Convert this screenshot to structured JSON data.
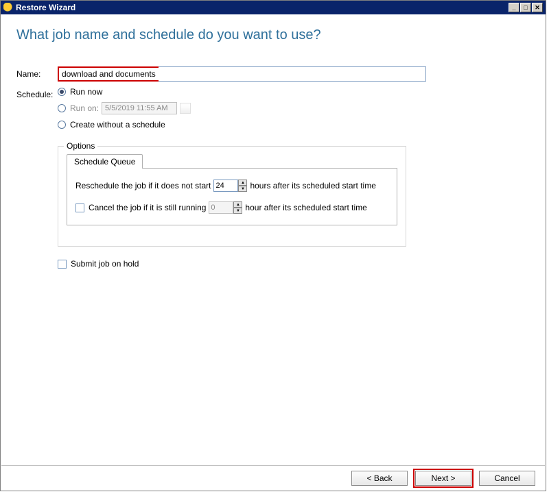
{
  "window": {
    "title": "Restore Wizard"
  },
  "heading": "What job name and schedule do you want to use?",
  "name": {
    "label": "Name:",
    "value": "download and documents"
  },
  "schedule": {
    "label": "Schedule:",
    "options": {
      "run_now": "Run now",
      "run_on": "Run on:",
      "run_on_date": "5/5/2019 11:55 AM",
      "create_without": "Create without a schedule"
    }
  },
  "options": {
    "legend": "Options",
    "tab": "Schedule Queue",
    "reschedule_pre": "Reschedule the job if it does not start",
    "reschedule_hours": "24",
    "reschedule_post": "hours after its scheduled start time",
    "cancel_pre": "Cancel the job if it is still running",
    "cancel_hours": "0",
    "cancel_post": "hour after its scheduled start time"
  },
  "submit_hold": "Submit job on hold",
  "buttons": {
    "back": "< Back",
    "next": "Next >",
    "cancel": "Cancel"
  }
}
